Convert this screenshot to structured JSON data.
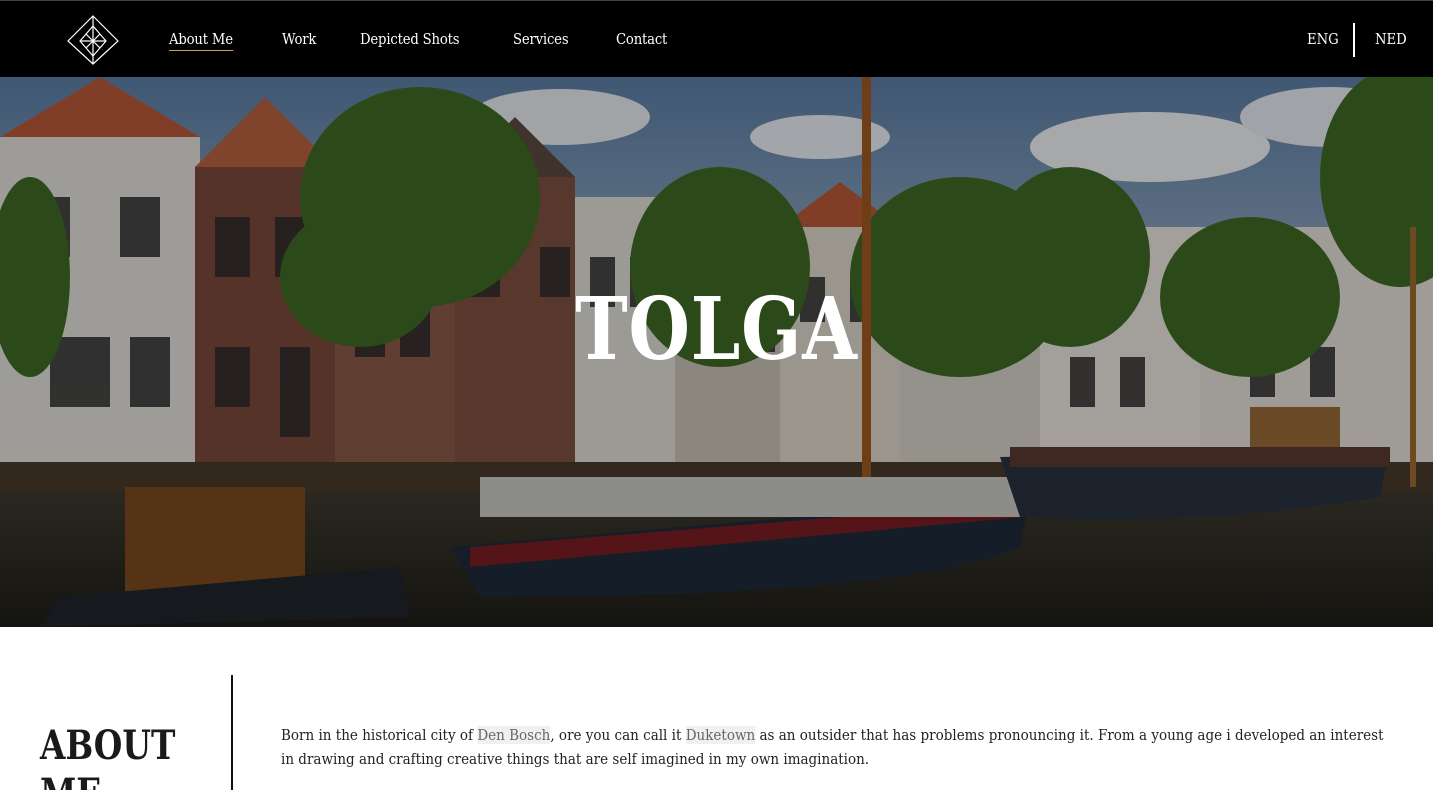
{
  "nav": {
    "links": [
      {
        "label": "About Me",
        "active": true
      },
      {
        "label": "Work"
      },
      {
        "label": "Depicted Shots"
      },
      {
        "label": "Services"
      },
      {
        "label": "Contact"
      }
    ],
    "lang": {
      "eng": "ENG",
      "ned": "NED"
    },
    "logo_icon": "diamond-logo-icon"
  },
  "hero": {
    "title": "TOLGA"
  },
  "about": {
    "heading": "ABOUT ME",
    "text_1": "Born in the historical city of ",
    "link_1": "Den Bosch",
    "text_2": ", ore you can call it ",
    "link_2": "Duketown",
    "text_3": " as an outsider that has problems pronouncing it. From a young age i developed an interest in drawing and crafting creative things that are self imagined in my own imagination."
  },
  "colors": {
    "nav_bg": "#000000",
    "active_underline": "#c9a24a",
    "hero_overlay": "rgba(0,0,0,0.35)"
  }
}
